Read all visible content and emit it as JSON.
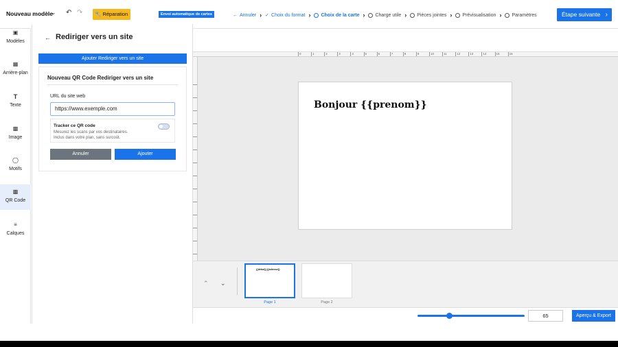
{
  "topbar": {
    "title": "Nouveau modèle",
    "repair_label": "Réparation",
    "auto_badge": "Envoi automatique de cartes",
    "next_label": "Étape suivante",
    "steps": [
      {
        "label": "Annuler",
        "state": "back"
      },
      {
        "label": "Choix du format",
        "state": "done"
      },
      {
        "label": "Choix de la carte",
        "state": "active"
      },
      {
        "label": "Charge utile",
        "state": "todo"
      },
      {
        "label": "Pièces jointes",
        "state": "todo"
      },
      {
        "label": "Prévisualisation",
        "state": "todo"
      },
      {
        "label": "Paramètres",
        "state": "todo"
      }
    ]
  },
  "sidebar": {
    "items": [
      {
        "label": "Modèles",
        "icon": "templates-icon"
      },
      {
        "label": "Arrière-plan",
        "icon": "background-icon"
      },
      {
        "label": "Texte",
        "icon": "text-icon"
      },
      {
        "label": "Image",
        "icon": "image-icon"
      },
      {
        "label": "Motifs",
        "icon": "shapes-icon"
      },
      {
        "label": "QR Code",
        "icon": "qr-code-icon"
      },
      {
        "label": "Calques",
        "icon": "layers-icon"
      }
    ],
    "selected": "QR Code"
  },
  "panel": {
    "title": "Rediriger vers un site",
    "add_bar_label": "Ajouter Rediriger vers un site",
    "card_title": "Nouveau QR Code Rediriger vers un site",
    "url_label": "URL du site web",
    "url_value": "https://www.exemple.com",
    "tracker_title": "Tracker ce QR code",
    "tracker_desc_1": "Mesurez les scans par vos destinataires.",
    "tracker_desc_2": "Inclus dans votre plan, sans surcoût.",
    "tracker_enabled": false,
    "cancel_label": "Annuler",
    "add_label": "Ajouter"
  },
  "ruler": {
    "top_ticks": [
      "0",
      "1",
      "2",
      "3",
      "4",
      "5",
      "6",
      "7",
      "8",
      "9",
      "10",
      "11",
      "12",
      "13",
      "14",
      "15",
      "16"
    ]
  },
  "canvas": {
    "text": "Bonjour {{prenom}}"
  },
  "pages": {
    "thumb_1_text": "{{début}} {{adresse}}",
    "page_1_label": "Page 1",
    "page_2_label": "Page 2",
    "selected_page": 1
  },
  "zoom": {
    "value": "65",
    "slider_fraction": 0.3,
    "export_label": "Aperçu & Export"
  },
  "colors": {
    "accent": "#1a73e8",
    "repair": "#f5b81d",
    "cancel": "#6c757d"
  }
}
